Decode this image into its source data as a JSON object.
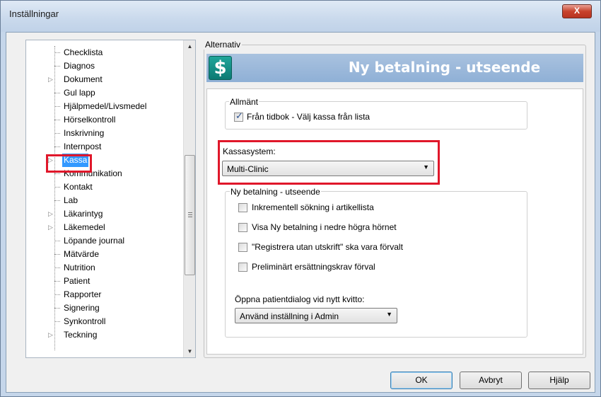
{
  "window": {
    "title": "Inställningar",
    "close_glyph": "X"
  },
  "tree": {
    "items": [
      {
        "label": "Checklista",
        "expandable": false
      },
      {
        "label": "Diagnos",
        "expandable": false
      },
      {
        "label": "Dokument",
        "expandable": true
      },
      {
        "label": "Gul lapp",
        "expandable": false
      },
      {
        "label": "Hjälpmedel/Livsmedel",
        "expandable": false
      },
      {
        "label": "Hörselkontroll",
        "expandable": false
      },
      {
        "label": "Inskrivning",
        "expandable": false
      },
      {
        "label": "Internpost",
        "expandable": false
      },
      {
        "label": "Kassa",
        "expandable": true,
        "selected": true
      },
      {
        "label": "Kommunikation",
        "expandable": false
      },
      {
        "label": "Kontakt",
        "expandable": false
      },
      {
        "label": "Lab",
        "expandable": false
      },
      {
        "label": "Läkarintyg",
        "expandable": true
      },
      {
        "label": "Läkemedel",
        "expandable": true
      },
      {
        "label": "Löpande journal",
        "expandable": false
      },
      {
        "label": "Mätvärde",
        "expandable": false
      },
      {
        "label": "Nutrition",
        "expandable": false
      },
      {
        "label": "Patient",
        "expandable": false
      },
      {
        "label": "Rapporter",
        "expandable": false
      },
      {
        "label": "Signering",
        "expandable": false
      },
      {
        "label": "Synkontroll",
        "expandable": false
      },
      {
        "label": "Teckning",
        "expandable": true
      }
    ]
  },
  "alternativ": {
    "group_label": "Alternativ",
    "icon_glyph": "$",
    "banner_title": "Ny betalning - utseende"
  },
  "allmant": {
    "group_label": "Allmänt",
    "checkbox_label": "Från tidbok - Välj kassa från lista",
    "checked": true
  },
  "kassasystem": {
    "label": "Kassasystem:",
    "selected_value": "Multi-Clinic"
  },
  "ny_betalning": {
    "group_label": "Ny betalning - utseende",
    "options": [
      {
        "label": "Inkrementell sökning i artikellista",
        "checked": false
      },
      {
        "label": "Visa Ny betalning i nedre högra hörnet",
        "checked": false
      },
      {
        "label": "\"Registrera utan utskrift\" ska vara förvalt",
        "checked": false
      },
      {
        "label": "Preliminärt ersättningskrav förval",
        "checked": false
      }
    ],
    "dialog_label": "Öppna patientdialog vid nytt kvitto:",
    "dialog_value": "Använd inställning i Admin"
  },
  "buttons": {
    "ok": "OK",
    "cancel": "Avbryt",
    "help": "Hjälp"
  },
  "colors": {
    "highlight_red": "#e0172a",
    "banner_blue": "#9cb9dc",
    "selection_blue": "#3399ff",
    "icon_teal": "#129088"
  }
}
